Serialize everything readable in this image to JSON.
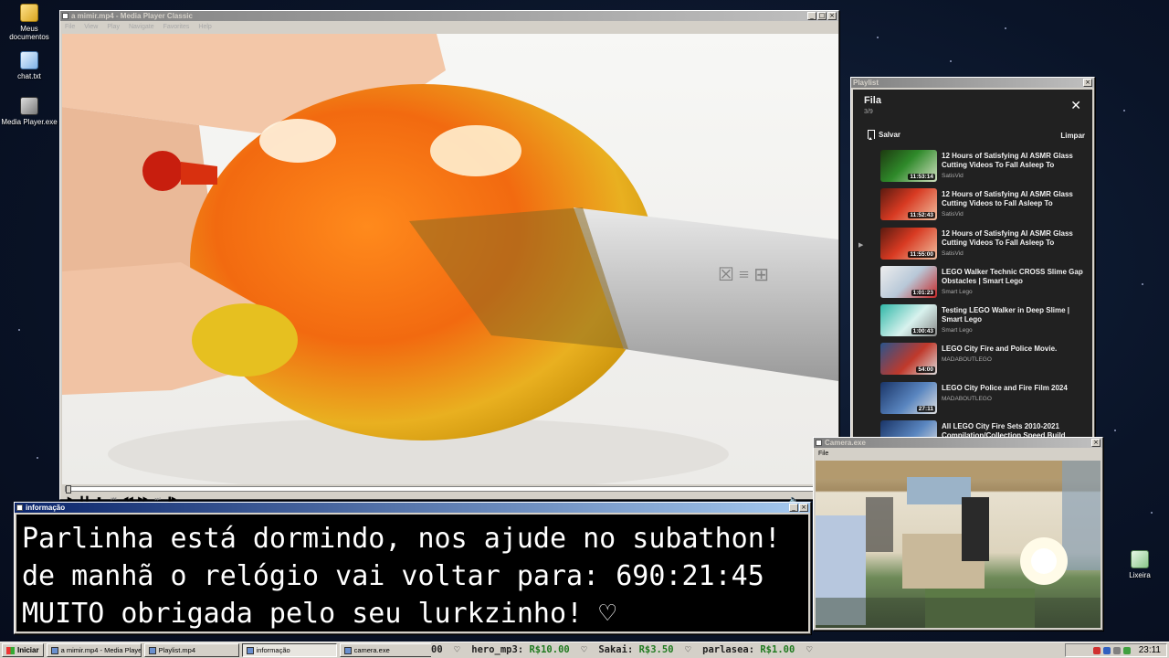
{
  "desktop": {
    "icons": [
      {
        "label": "Meus documentos",
        "icon": "folder-icon"
      },
      {
        "label": "chat.txt",
        "icon": "text-file-icon"
      },
      {
        "label": "Media Player.exe",
        "icon": "media-player-icon"
      },
      {
        "label": "Lixeira",
        "icon": "recycle-bin-icon"
      }
    ]
  },
  "media_player": {
    "title": "a mimir.mp4 - Media Player Classic",
    "menu": [
      "File",
      "View",
      "Play",
      "Navigate",
      "Favorites",
      "Help"
    ],
    "controls": [
      "play",
      "pause",
      "stop",
      "prev",
      "rewind",
      "fast-forward",
      "next",
      "frame-step"
    ]
  },
  "playlist": {
    "window_title": "Playlist",
    "heading": "Fila",
    "count": "3/9",
    "save_label": "Salvar",
    "clear_label": "Limpar",
    "items": [
      {
        "title": "12 Hours of Satisfying AI ASMR Glass Cutting Videos To Fall Asleep To",
        "channel": "SatisVid",
        "duration": "11:53:14",
        "current": false
      },
      {
        "title": "12 Hours of Satisfying AI ASMR Glass Cutting Videos to Fall Asleep To",
        "channel": "SatisVid",
        "duration": "11:52:43",
        "current": false
      },
      {
        "title": "12 Hours of Satisfying AI ASMR Glass Cutting Videos To Fall Asleep To",
        "channel": "SatisVid",
        "duration": "11:55:00",
        "current": true
      },
      {
        "title": "LEGO Walker Technic CROSS Slime Gap Obstacles | Smart Lego",
        "channel": "Smart Lego",
        "duration": "1:01:23",
        "current": false
      },
      {
        "title": "Testing LEGO Walker in Deep Slime | Smart Lego",
        "channel": "Smart Lego",
        "duration": "1:00:43",
        "current": false
      },
      {
        "title": "LEGO City Fire and Police Movie.",
        "channel": "MADABOUTLEGO",
        "duration": "54:00",
        "current": false
      },
      {
        "title": "LEGO City Police and Fire Film 2024",
        "channel": "MADABOUTLEGO",
        "duration": "27:11",
        "current": false
      },
      {
        "title": "All LEGO City Fire Sets 2010-2021 Compilation/Collection Speed Build",
        "channel": "",
        "duration": "",
        "current": false
      }
    ],
    "current_indicator": "▶"
  },
  "info_window": {
    "title": "informação",
    "lines": [
      "Parlinha está dormindo, nos ajude no subathon!",
      "de manhã o relógio vai voltar para:  690:21:45",
      "MUITO obrigada pelo seu lurkzinho! ♡"
    ]
  },
  "camera": {
    "title": "Camera.exe",
    "menu": [
      "File"
    ]
  },
  "taskbar": {
    "start_label": "Iniciar",
    "tasks": [
      {
        "label": "a mimir.mp4 - Media Playe...",
        "pressed": false
      },
      {
        "label": "Playlist.mp4",
        "pressed": false
      },
      {
        "label": "informação",
        "pressed": true
      },
      {
        "label": "camera.exe",
        "pressed": false
      }
    ],
    "ticker": [
      {
        "text": "00  ♡  hero_mp3: ",
        "amount": "R$10.00"
      },
      {
        "text": "  ♡  Sakai: ",
        "amount": "R$3.50"
      },
      {
        "text": "  ♡  parlasea: ",
        "amount": "R$1.00"
      },
      {
        "text": "  ♡",
        "amount": ""
      }
    ],
    "clock": "23:11"
  },
  "colors": {
    "titlebar_active": "#0a246a",
    "playlist_bg": "#212121",
    "ticker_amount": "#1f7a1f"
  }
}
